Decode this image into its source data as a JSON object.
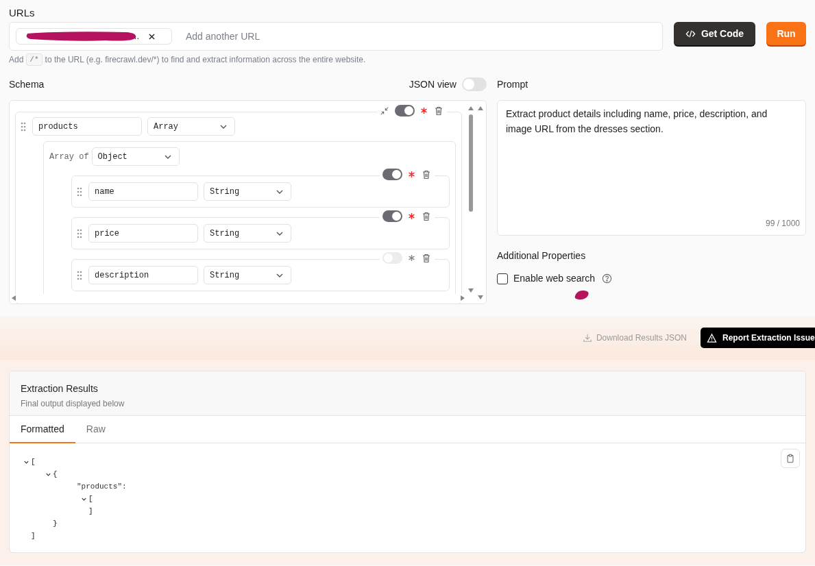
{
  "urls": {
    "label": "URLs",
    "chips": [
      {
        "text": ".."
      }
    ],
    "placeholder": "Add another URL",
    "hint_before": "Add",
    "hint_code": "/*",
    "hint_after": "to the URL (e.g. firecrawl.dev/*) to find and extract information across the entire website."
  },
  "actions": [
    {
      "kind": "code",
      "label": "Get Code"
    },
    {
      "kind": "run",
      "label": "Run"
    }
  ],
  "schema": {
    "label": "Schema",
    "json_view": {
      "label": "JSON view",
      "on": false
    },
    "fields": [
      {
        "name": "products",
        "type": "Array",
        "required": true,
        "collapsible": true,
        "array_of_label": "Array of",
        "array_of": "Object",
        "children": [
          {
            "name": "name",
            "type": "String",
            "required": true
          },
          {
            "name": "price",
            "type": "String",
            "required": true
          },
          {
            "name": "description",
            "type": "String",
            "required": false
          }
        ]
      }
    ]
  },
  "prompt": {
    "label": "Prompt",
    "value": "Extract product details including name, price, description, and image URL from the dresses section.",
    "count": "99 / 1000"
  },
  "additional": {
    "label": "Additional Properties",
    "options": [
      {
        "label": "Enable web search",
        "checked": false
      }
    ]
  },
  "toolbar": {
    "download": "Download Results JSON",
    "report": "Report Extraction Issue"
  },
  "results": {
    "title": "Extraction Results",
    "subtitle": "Final output displayed below",
    "tabs": [
      {
        "label": "Formatted",
        "selected": true
      },
      {
        "label": "Raw",
        "selected": false
      }
    ],
    "tree": {
      "open": "[",
      "close": "]",
      "expanded": true,
      "children": [
        {
          "open": "{",
          "close": "}",
          "expanded": true,
          "children": [
            {
              "key": "\"products\":",
              "open": "[",
              "close": "]",
              "expanded": true
            }
          ]
        }
      ]
    }
  }
}
